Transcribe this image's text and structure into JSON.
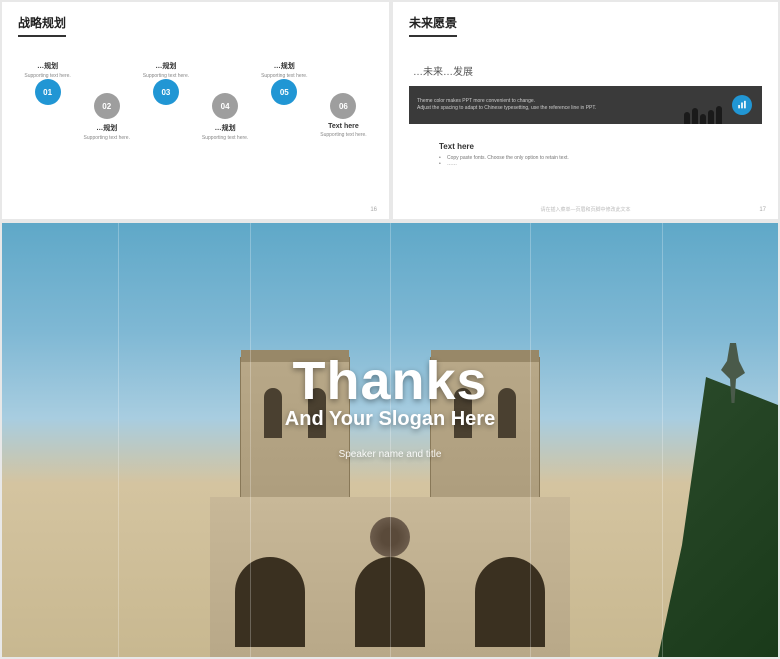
{
  "slide16": {
    "title": "战略规划",
    "items": [
      {
        "num": "01",
        "label": "…规划",
        "sub": "Supporting text here."
      },
      {
        "num": "02",
        "label": "…规划",
        "sub": "Supporting text here."
      },
      {
        "num": "03",
        "label": "…规划",
        "sub": "Supporting text here."
      },
      {
        "num": "04",
        "label": "…规划",
        "sub": "Supporting text here."
      },
      {
        "num": "05",
        "label": "…规划",
        "sub": "Supporting text here."
      },
      {
        "num": "06",
        "label": "Text here",
        "sub": "Supporting text here."
      }
    ],
    "page": "16"
  },
  "slide17": {
    "title": "未来愿景",
    "subtitle": "…未来…发展",
    "dark_line1": "Theme color makes PPT more convenient to change.",
    "dark_line2": "Adjust the spacing to adapt to Chinese typesetting, use the reference line in PPT.",
    "text_here_title": "Text here",
    "bullet1": "Copy paste fonts. Choose the only option to retain text.",
    "bullet2": "……",
    "page": "17",
    "footer": "请在插入菜单—页眉和页脚中修改此文本"
  },
  "slide18": {
    "thanks": "Thanks",
    "slogan": "And Your Slogan Here",
    "speaker": "Speaker name and title"
  }
}
